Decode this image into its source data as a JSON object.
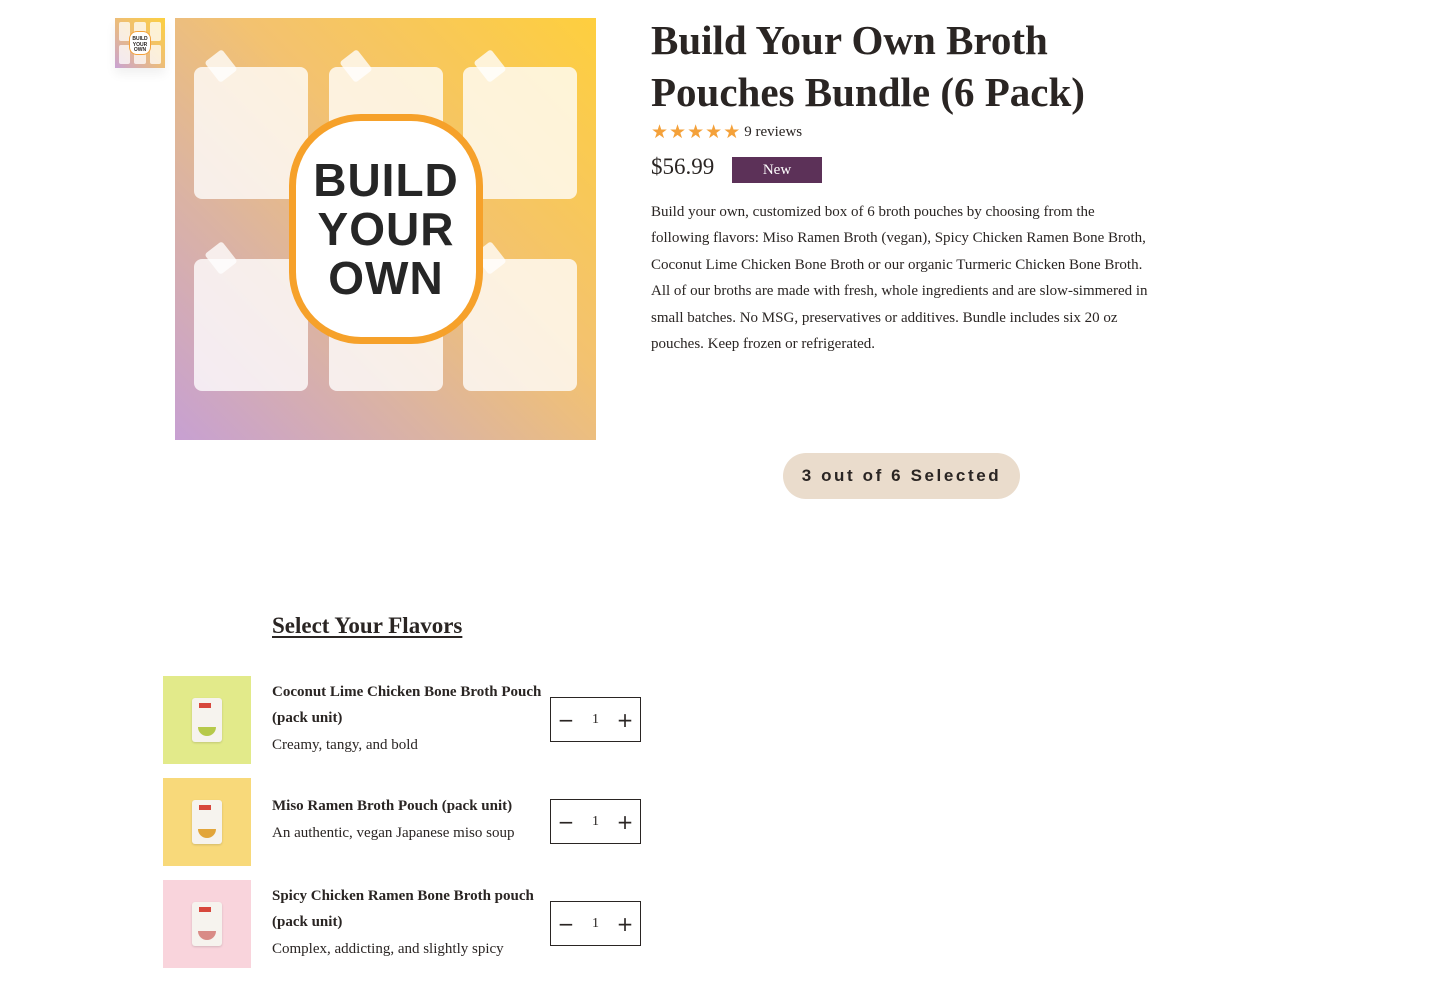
{
  "gallery": {
    "thumbnail_text": [
      "BUILD",
      "YOUR",
      "OWN"
    ],
    "hero_text": [
      "BUILD",
      "YOUR",
      "OWN"
    ]
  },
  "product": {
    "title": "Build Your Own Broth Pouches Bundle (6 Pack)",
    "rating_stars": 5,
    "star_icon": "star-icon",
    "reviews": "9 reviews",
    "price": "$56.99",
    "badge": "New",
    "description": "Build your own, customized box of 6 broth pouches by choosing from the following flavors: Miso Ramen Broth (vegan), Spicy Chicken Ramen Bone Broth, Coconut Lime Chicken Bone Broth or our organic Turmeric Chicken Bone Broth. All of our broths are made with fresh, whole ingredients and are slow-simmered in small batches. No MSG, preservatives or additives. Bundle includes six 20 oz pouches. Keep frozen or refrigerated."
  },
  "selection": {
    "counter": "3 out of 6 Selected"
  },
  "flavors_section": {
    "title": "Select Your Flavors",
    "items": [
      {
        "name": "Coconut Lime Chicken Bone Broth Pouch (pack unit)",
        "description": "Creamy, tangy, and bold",
        "quantity": "1",
        "image_bg": "#e2ea8a",
        "accent": "#b6c94a"
      },
      {
        "name": "Miso Ramen Broth Pouch (pack unit)",
        "description": "An authentic, vegan Japanese miso soup",
        "quantity": "1",
        "image_bg": "#f8d97a",
        "accent": "#e2a53a"
      },
      {
        "name": "Spicy Chicken Ramen Bone Broth pouch (pack unit)",
        "description": "Complex, addicting, and slightly spicy",
        "quantity": "1",
        "image_bg": "#f9d4dc",
        "accent": "#d98b86"
      }
    ],
    "decrement_symbol": "−",
    "increment_symbol": "+"
  },
  "colors": {
    "star": "#f4a13a",
    "badge_bg": "#5c3158",
    "counter_bg": "#eadccc",
    "hero_badge_border": "#f6a12a"
  }
}
